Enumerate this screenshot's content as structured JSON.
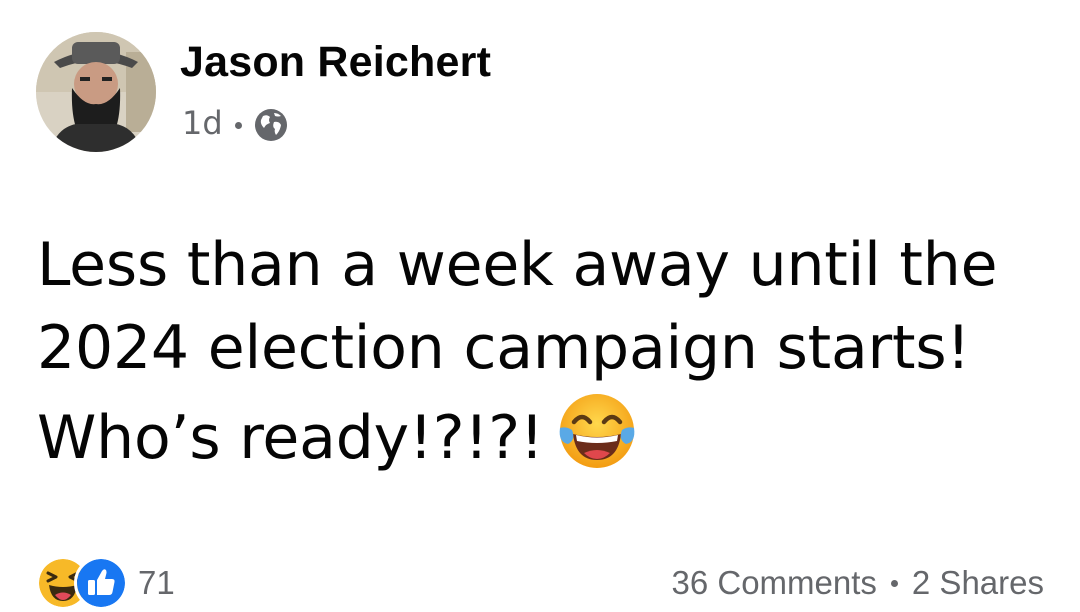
{
  "post": {
    "author_name": "Jason Reichert",
    "timestamp": "1d",
    "audience_icon": "globe-icon",
    "text_lines": [
      "Less than a week away until the",
      "2024 election campaign starts!",
      "Who’s ready!?!?!"
    ],
    "text_emoji": "face-with-tears-of-joy-icon"
  },
  "footer": {
    "reaction_icons": [
      "haha-reaction-icon",
      "like-reaction-icon"
    ],
    "reaction_count": "71",
    "comments_label": "36 Comments",
    "shares_label": "2 Shares"
  },
  "colors": {
    "text": "#050505",
    "secondary_text": "#65676b",
    "like_blue": "#1877f2",
    "haha_yellow": "#f7b928"
  }
}
